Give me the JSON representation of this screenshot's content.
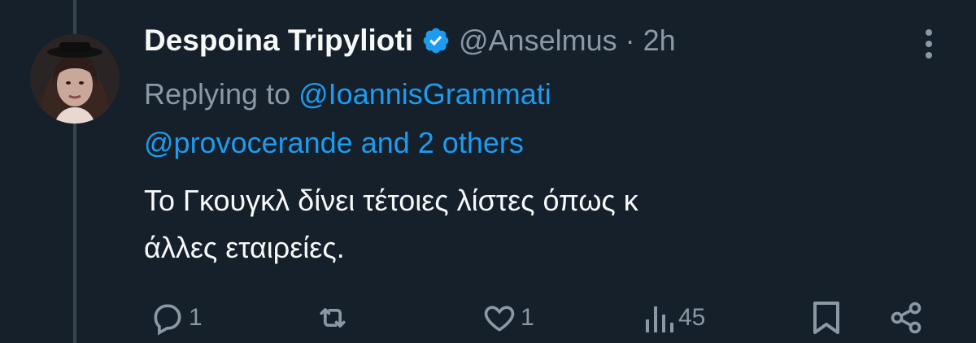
{
  "tweet": {
    "display_name": "Despoina Tripylioti",
    "handle": "@Anselmus",
    "separator": "·",
    "time": "2h",
    "replying_prefix": "Replying to",
    "reply_user": "@IoannisGrammati",
    "reply_user2": "@provocerande",
    "reply_others": "and 2 others",
    "text_line1": "Το Γκουγκλ δίνει τέτοιες λίστες όπως κ",
    "text_line2": "άλλες εταιρείες."
  },
  "actions": {
    "reply_count": "1",
    "retweet_count": "",
    "like_count": "1",
    "views_count": "45"
  },
  "icons": {
    "verified": "verified-badge-icon",
    "more": "more-vertical-icon",
    "reply": "reply-icon",
    "retweet": "retweet-icon",
    "like": "heart-icon",
    "views": "views-chart-icon",
    "bookmark": "bookmark-icon",
    "share": "share-icon"
  },
  "colors": {
    "background": "#15202b",
    "accent": "#1d9bf0",
    "muted": "#8b98a5",
    "text": "#f7f9f9"
  }
}
